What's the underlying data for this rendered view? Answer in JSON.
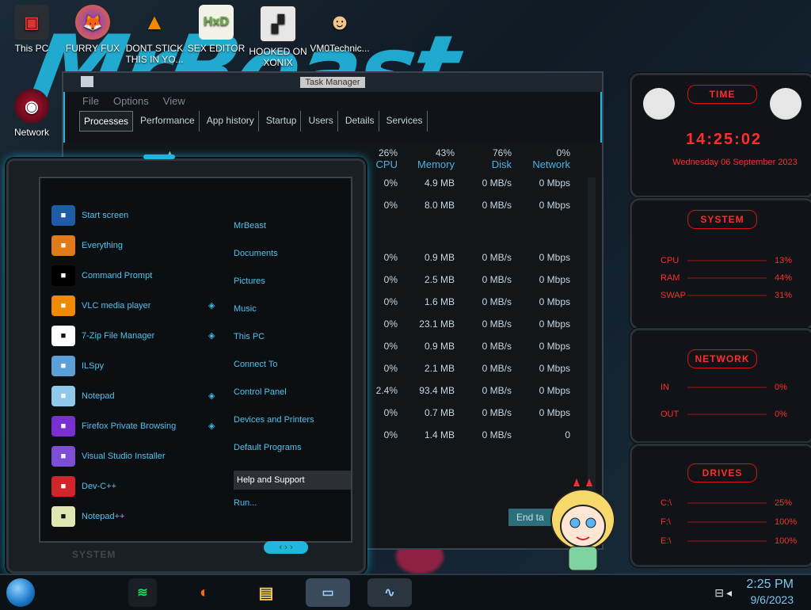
{
  "wallpaper": {
    "big_text": "MrBeast",
    "accent": "#22b9e1"
  },
  "desktop_icons": [
    {
      "label": "This PC",
      "icon": "this-pc-icon"
    },
    {
      "label": "FURRY FUX",
      "icon": "firefox-icon"
    },
    {
      "label": "DONT STICK THIS IN YO...",
      "icon": "vlc-icon"
    },
    {
      "label": "SEX EDITOR",
      "icon": "hxd-icon"
    },
    {
      "label": "HOOKED ON XONIX",
      "icon": "xonix-icon"
    },
    {
      "label": "VM0Technic...",
      "icon": "doctor-icon"
    },
    {
      "label": "Network",
      "icon": "network-icon"
    }
  ],
  "task_manager": {
    "title": "Task Manager",
    "menu": [
      "File",
      "Options",
      "View"
    ],
    "tabs": [
      "Processes",
      "Performance",
      "App history",
      "Startup",
      "Users",
      "Details",
      "Services"
    ],
    "active_tab": "Processes",
    "columns": [
      {
        "pct": "26%",
        "name": "CPU"
      },
      {
        "pct": "43%",
        "name": "Memory"
      },
      {
        "pct": "76%",
        "name": "Disk"
      },
      {
        "pct": "0%",
        "name": "Network"
      }
    ],
    "rows": [
      {
        "cpu": "0%",
        "mem": "4.9 MB",
        "disk": "0 MB/s",
        "net": "0 Mbps"
      },
      {
        "cpu": "0%",
        "mem": "8.0 MB",
        "disk": "0 MB/s",
        "net": "0 Mbps"
      },
      {
        "cpu": "0%",
        "mem": "0.9 MB",
        "disk": "0 MB/s",
        "net": "0 Mbps"
      },
      {
        "cpu": "0%",
        "mem": "2.5 MB",
        "disk": "0 MB/s",
        "net": "0 Mbps"
      },
      {
        "cpu": "0%",
        "mem": "1.6 MB",
        "disk": "0 MB/s",
        "net": "0 Mbps"
      },
      {
        "cpu": "0%",
        "mem": "23.1 MB",
        "disk": "0 MB/s",
        "net": "0 Mbps"
      },
      {
        "cpu": "0%",
        "mem": "0.9 MB",
        "disk": "0 MB/s",
        "net": "0 Mbps"
      },
      {
        "cpu": "0%",
        "mem": "2.1 MB",
        "disk": "0 MB/s",
        "net": "0 Mbps"
      },
      {
        "cpu": "2.4%",
        "mem": "93.4 MB",
        "disk": "0 MB/s",
        "net": "0 Mbps"
      },
      {
        "cpu": "0%",
        "mem": "0.7 MB",
        "disk": "0 MB/s",
        "net": "0 Mbps"
      },
      {
        "cpu": "0%",
        "mem": "1.4 MB",
        "disk": "0 MB/s",
        "net": "0"
      }
    ],
    "end_task_label": "End ta"
  },
  "start_menu": {
    "left_items": [
      {
        "label": "Start screen",
        "icon": "start-screen-icon",
        "color": "#1f5ca8",
        "submenu": false
      },
      {
        "label": "Everything",
        "icon": "search-icon",
        "color": "#e07b18",
        "submenu": false
      },
      {
        "label": "Command Prompt",
        "icon": "terminal-icon",
        "color": "#000000",
        "submenu": false
      },
      {
        "label": "VLC media player",
        "icon": "vlc-icon",
        "color": "#f08a00",
        "submenu": true
      },
      {
        "label": "7-Zip File Manager",
        "icon": "7zip-icon",
        "color": "#ffffff",
        "submenu": true
      },
      {
        "label": "ILSpy",
        "icon": "ilspy-icon",
        "color": "#5da0d8",
        "submenu": false
      },
      {
        "label": "Notepad",
        "icon": "notepad-icon",
        "color": "#8ec9ea",
        "submenu": true
      },
      {
        "label": "Firefox Private Browsing",
        "icon": "firefox-private-icon",
        "color": "#7a2fd0",
        "submenu": true
      },
      {
        "label": "Visual Studio Installer",
        "icon": "visual-studio-icon",
        "color": "#7c4fd6",
        "submenu": false
      },
      {
        "label": "Dev-C++",
        "icon": "devcpp-icon",
        "color": "#d0262a",
        "submenu": false
      },
      {
        "label": "Notepad++",
        "icon": "notepadpp-icon",
        "color": "#dfe8b0",
        "submenu": false
      }
    ],
    "right_items": [
      "MrBeast",
      "Documents",
      "Pictures",
      "Music",
      "This PC",
      "Connect To",
      "Control Panel",
      "Devices and Printers",
      "Default Programs",
      "Help and Support",
      "Run..."
    ],
    "selected_right": "Help and Support",
    "footer_label": "SYSTEM"
  },
  "gadgets": {
    "time": {
      "title": "TIME",
      "clock": "14:25:02",
      "date": "Wednesday 06 September 2023"
    },
    "system": {
      "title": "SYSTEM",
      "rows": [
        {
          "label": "CPU",
          "value": "13%"
        },
        {
          "label": "RAM",
          "value": "44%"
        },
        {
          "label": "SWAP",
          "value": "31%"
        }
      ]
    },
    "network": {
      "title": "NETWORK",
      "rows": [
        {
          "label": "IN",
          "value": "0%"
        },
        {
          "label": "OUT",
          "value": "0%"
        }
      ]
    },
    "drives": {
      "title": "DRIVES",
      "rows": [
        {
          "label": "C:\\",
          "value": "25%"
        },
        {
          "label": "F:\\",
          "value": "100%"
        },
        {
          "label": "E:\\",
          "value": "100%"
        }
      ]
    }
  },
  "taskbar": {
    "time": "2:25 PM",
    "date": "9/6/2023",
    "pinned": [
      "spotify-icon",
      "firefox-icon",
      "file-explorer-icon",
      "task-manager-icon",
      "performance-icon"
    ]
  }
}
